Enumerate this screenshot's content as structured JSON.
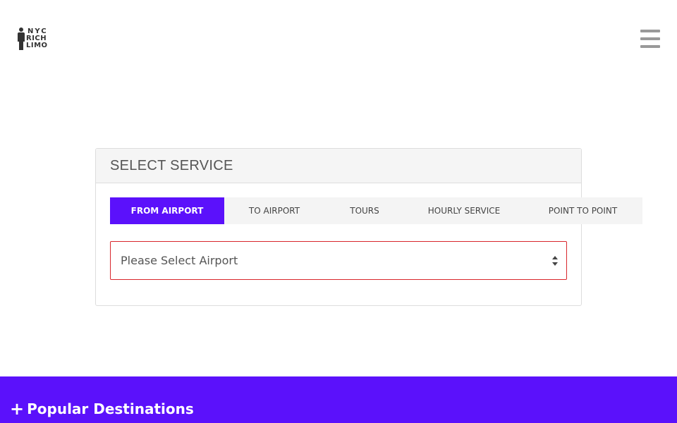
{
  "header": {
    "logo_lines": [
      "NYC",
      "RICH",
      "LIMO"
    ]
  },
  "panel": {
    "heading": "SELECT SERVICE",
    "tabs": [
      {
        "label": "FROM AIRPORT",
        "active": true
      },
      {
        "label": "TO AIRPORT",
        "active": false
      },
      {
        "label": "TOURS",
        "active": false
      },
      {
        "label": "HOURLY SERVICE",
        "active": false
      },
      {
        "label": "POINT TO POINT",
        "active": false
      }
    ],
    "select": {
      "value": "Please Select Airport"
    }
  },
  "footer": {
    "plus_symbol": "+",
    "popular_label": "Popular Destinations"
  },
  "colors": {
    "accent": "#5b11fb",
    "select_border": "#d9262c"
  }
}
